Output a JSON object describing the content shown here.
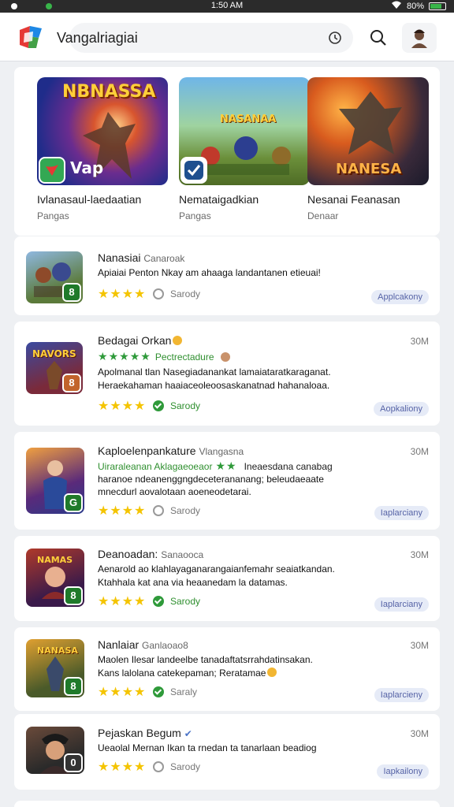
{
  "status": {
    "time": "1:50 AM",
    "battery": "80%"
  },
  "header": {
    "search_query": "Vangalriagiai"
  },
  "featured": [
    {
      "title": "Ivlanasaul-laedaatian",
      "subtitle": "Pangas",
      "thumb_text": "NBNASSA",
      "overlay": "Vap"
    },
    {
      "title": "Nemataigadkian",
      "subtitle": "Pangas",
      "thumb_text": "NASANAA"
    },
    {
      "title": "Nesanai Feanasan",
      "subtitle": "Denaar",
      "thumb_text": "NANESA"
    }
  ],
  "rows": [
    {
      "title": "Nanasiai",
      "title_sub": "Canaroak",
      "size": "",
      "desc": "Apiaiai Penton Nkay am ahaaga landantanen etieuai!",
      "desc2": "",
      "mark": "empty",
      "mark_label": "Sarody",
      "action": "Applcakony",
      "badge": "8",
      "badge_color": "#1f7a2a"
    },
    {
      "title": "Bedagai Orkan",
      "title_sub": "",
      "size": "30M",
      "subtitle_green": "Pectrectadure",
      "desc": "Apolmanal tlan Nasegiadanankat lamaiataratkaraganat.",
      "desc2": "Heraekahaman haaiaceoleoosaskanatnad hahanaloaa.",
      "mark": "ok",
      "mark_label": "Sarody",
      "action": "Aopkaliony",
      "badge": "8",
      "badge_color": "#c2642b",
      "thumb_text": "NAVORS"
    },
    {
      "title": "Kaploelenpankature",
      "title_sub": "Vlangasna",
      "size": "30M",
      "desc_green": "Uiraraleanan Aklagaeoeaor",
      "desc": "Ineaesdana canabag",
      "desc2": "haranoe ndeanenggngdeceterananang; beleudaeaate",
      "desc3": "mnecdurl aovalotaan aoeneodetarai.",
      "mark": "empty",
      "mark_label": "Sarody",
      "action": "Iaplarciany",
      "badge": "G",
      "badge_color": "#1f7a2a"
    },
    {
      "title": "Deanoadan:",
      "title_sub": "Sanaooca",
      "size": "30M",
      "desc": "Aenarold ao klahlayaganarangaianfemahr seaiatkandan.",
      "desc2": "Ktahhala kat ana via heaanedam la datamas.",
      "mark": "ok",
      "mark_label": "Sarody",
      "label_green": true,
      "action": "Iaplarciany",
      "badge": "8",
      "badge_color": "#1f7a2a",
      "thumb_text": "NAMAS"
    },
    {
      "title": "Nanlaiar",
      "title_sub": "Ganlaoao8",
      "size": "30M",
      "desc": "Maolen Ilesar landeelbe tanadaftatsrrahdatinsakan.",
      "desc2": "Kans lalolana catekepaman; Reratamae",
      "mark": "ok",
      "mark_label": "Saraly",
      "action": "Iaplarcieny",
      "badge": "8",
      "badge_color": "#1f7a2a",
      "thumb_text": "NANASA"
    },
    {
      "title": "Pejaskan Begum",
      "title_sub": "",
      "size": "30M",
      "desc": "Ueaolal Mernan Ikan ta rnedan ta tanarlaan beadiog",
      "desc2": "",
      "mark": "empty",
      "mark_label": "Sarody",
      "action": "Iapkailony",
      "badge": "0",
      "badge_color": "#333333"
    }
  ]
}
